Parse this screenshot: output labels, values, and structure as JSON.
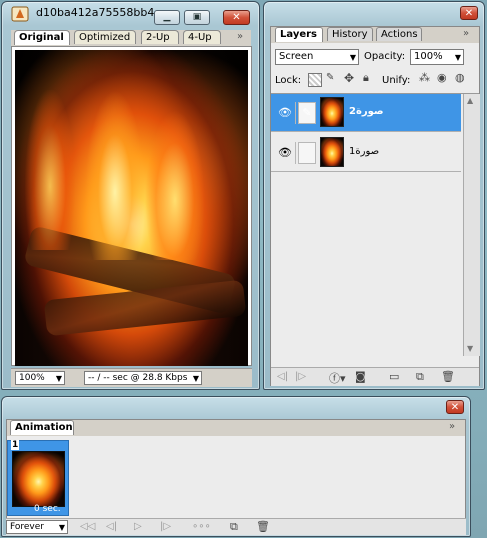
{
  "document_window": {
    "title": "d10ba412a75558bb4...",
    "tabs": [
      "Original",
      "Optimized",
      "2-Up",
      "4-Up"
    ],
    "active_tab": "Original",
    "zoom": "100%",
    "status": "-- / -- sec @ 28.8 Kbps"
  },
  "layers_panel": {
    "tabs": [
      "Layers",
      "History",
      "Actions"
    ],
    "active_tab": "Layers",
    "blend_mode": "Screen",
    "opacity_label": "Opacity:",
    "opacity_value": "100%",
    "lock_label": "Lock:",
    "unify_label": "Unify:",
    "layers": [
      {
        "name": "صورة2",
        "selected": true,
        "visible": true
      },
      {
        "name": "صورة1",
        "selected": false,
        "visible": true
      }
    ]
  },
  "animation_panel": {
    "tab": "Animation",
    "frames": [
      {
        "number": "1",
        "delay": "0 sec.",
        "selected": true
      }
    ],
    "loop": "Forever"
  },
  "colors": {
    "selection": "#3f95e6",
    "close_button": "#c94a32"
  }
}
